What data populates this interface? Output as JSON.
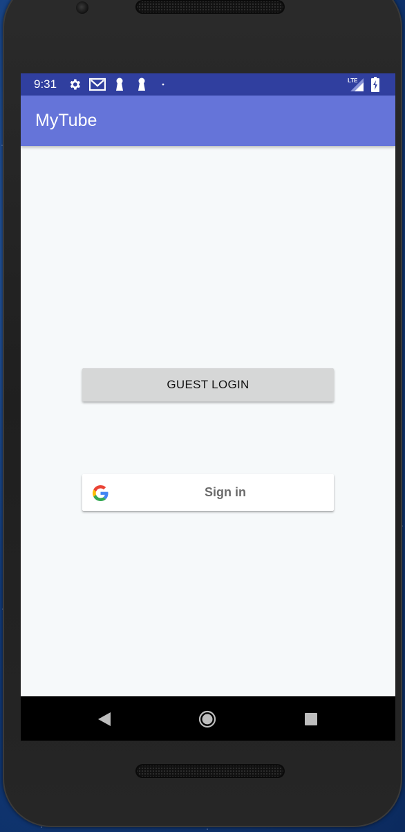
{
  "status_bar": {
    "time": "9:31",
    "left_icons": [
      "gear-icon",
      "gmail-icon",
      "keyhole-icon",
      "keyhole-icon",
      "dot-icon"
    ],
    "right_icons": [
      "lte-signal-icon",
      "battery-charging-icon"
    ],
    "network_label": "LTE"
  },
  "app_bar": {
    "title": "MyTube"
  },
  "main": {
    "guest_button_label": "GUEST LOGIN",
    "google_button_label": "Sign in"
  },
  "nav_bar": {
    "buttons": [
      "back-icon",
      "home-icon",
      "recents-icon"
    ]
  },
  "colors": {
    "status_bar": "#303f9f",
    "app_bar": "#6574d9",
    "background": "#f6f9fa",
    "guest_button": "#d6d7d7",
    "google_button": "#ffffff",
    "nav_bar": "#000000"
  }
}
